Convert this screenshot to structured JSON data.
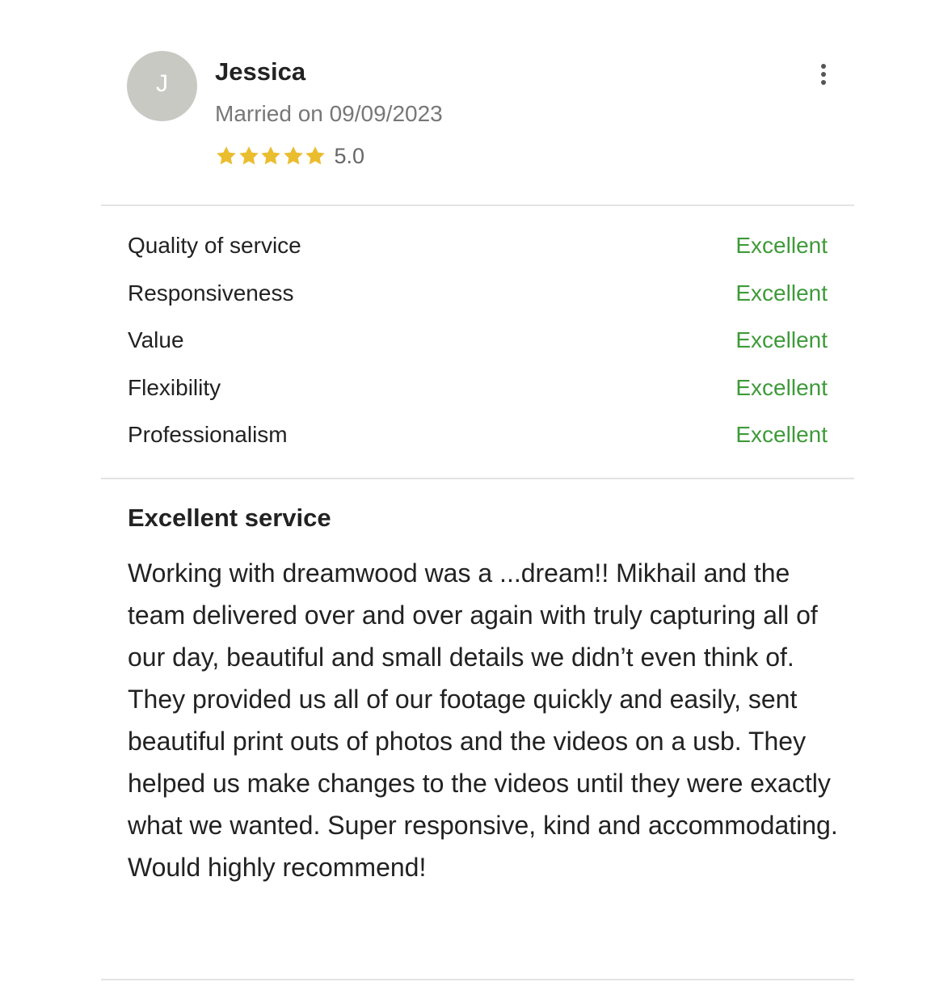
{
  "review": {
    "avatar_initial": "J",
    "reviewer_name": "Jessica",
    "married_text": "Married on 09/09/2023",
    "star_count": 5,
    "rating": "5.0",
    "more_icon": "more-vertical-icon",
    "categories": [
      {
        "label": "Quality of service",
        "grade": "Excellent"
      },
      {
        "label": "Responsiveness",
        "grade": "Excellent"
      },
      {
        "label": "Value",
        "grade": "Excellent"
      },
      {
        "label": "Flexibility",
        "grade": "Excellent"
      },
      {
        "label": "Professionalism",
        "grade": "Excellent"
      }
    ],
    "title": "Excellent service",
    "body": "Working with dreamwood was a ...dream!! Mikhail and the team delivered over and over again with truly capturing all of our day, beautiful and small details we didn’t even think of. They provided us all of our footage quickly and easily, sent beautiful print outs of photos and the videos on a usb. They helped us make changes to the videos until they were exactly what we wanted. Super responsive, kind and accommodating. Would highly recommend!"
  },
  "colors": {
    "star": "#eabd2f",
    "grade": "#3f9a3a",
    "avatar_bg": "#c9c9c4",
    "divider": "#e3e3e3"
  }
}
